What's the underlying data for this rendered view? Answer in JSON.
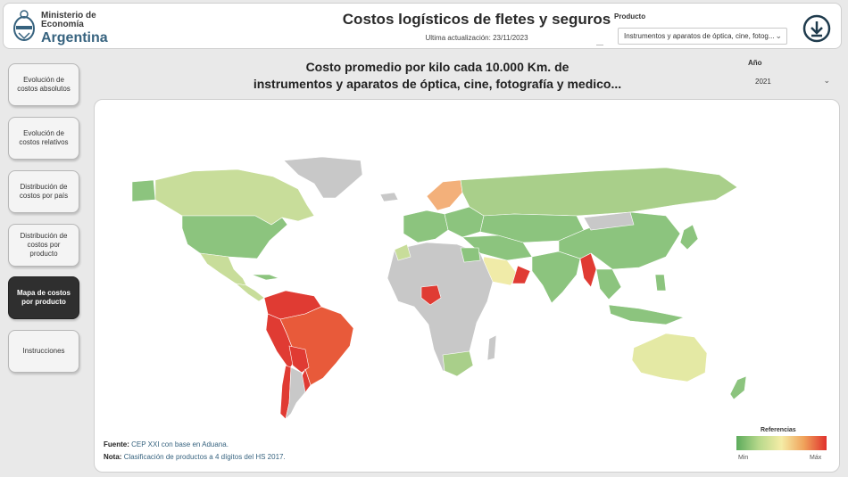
{
  "header": {
    "logo": {
      "line1": "Ministerio de",
      "line2": "Economía",
      "line3": "Argentina"
    },
    "title": "Costos logísticos de fletes y seguros",
    "updated": "Ultima actualización: 23/11/2023",
    "product_label": "Producto",
    "product_value": "Instrumentos y aparatos de óptica, cine, fotog...",
    "download_icon": "download-icon"
  },
  "nav": {
    "items": [
      {
        "label": "Evolución de costos absolutos",
        "active": false
      },
      {
        "label": "Evolución de costos relativos",
        "active": false
      },
      {
        "label": "Distribución de costos por país",
        "active": false
      },
      {
        "label": "Distribución de costos por producto",
        "active": false
      },
      {
        "label": "Mapa de costos por producto",
        "active": true
      },
      {
        "label": "Instrucciones",
        "active": false
      }
    ]
  },
  "main": {
    "title_line1": "Costo promedio por kilo cada 10.000 Km. de",
    "title_line2": "instrumentos y aparatos de óptica, cine, fotografía y medico...",
    "year_label": "Año",
    "year_value": "2021"
  },
  "footer": {
    "source_label": "Fuente:",
    "source_text": "CEP XXI con base en Aduana.",
    "note_label": "Nota:",
    "note_text": "Clasificación de productos a 4 dígitos del HS 2017."
  },
  "legend": {
    "title": "Referencias",
    "min": "Min",
    "max": "Máx",
    "gradient_colors": [
      "#5cab5c",
      "#b8d98c",
      "#f5eca6",
      "#f0a25a",
      "#e0312d"
    ]
  },
  "colors": {
    "accent_blue": "#37637f",
    "nodata_gray": "#c8c8c8",
    "green": "#8cc47e",
    "light_green": "#c8dd9a",
    "yellow": "#f0eba8",
    "orange": "#f3b07a",
    "red": "#e03b33"
  }
}
